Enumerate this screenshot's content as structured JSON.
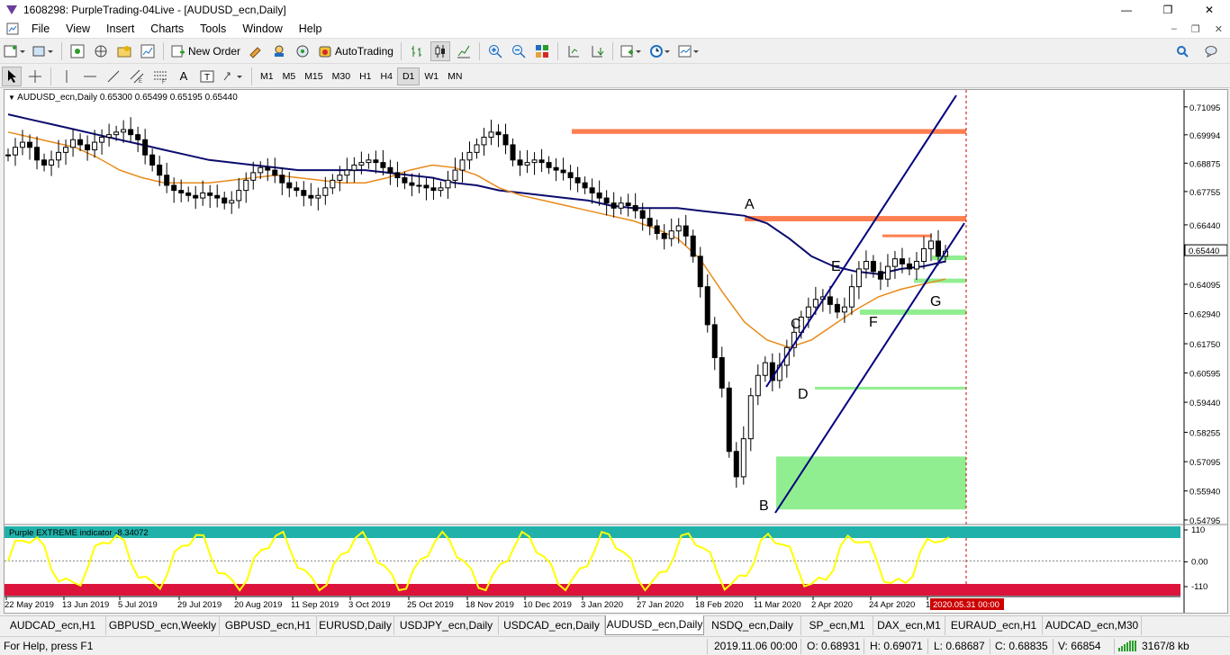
{
  "window": {
    "title": "1608298: PurpleTrading-04Live - [AUDUSD_ecn,Daily]",
    "minimize": "—",
    "maximize": "❐",
    "close": "✕"
  },
  "menu": [
    "File",
    "View",
    "Insert",
    "Charts",
    "Tools",
    "Window",
    "Help"
  ],
  "toolbar": {
    "new_order": "New Order",
    "autotrading": "AutoTrading",
    "timeframes": [
      "M1",
      "M5",
      "M15",
      "M30",
      "H1",
      "H4",
      "D1",
      "W1",
      "MN"
    ],
    "active_timeframe": "D1"
  },
  "chart": {
    "header": "AUDUSD_ecn,Daily  0.65300 0.65499 0.65195 0.65440",
    "current_price": "0.65440",
    "indicator_label": "Purple EXTREME indicator -8.34072",
    "indicator_levels": [
      "110",
      "0.00",
      "-110"
    ],
    "cursor_date": "2020.05.31 00:00",
    "wave_labels": [
      "A",
      "B",
      "C",
      "D",
      "E",
      "F",
      "G"
    ],
    "colors": {
      "resistance": "#ff7f50",
      "support": "#90ee90",
      "channel": "#00007f",
      "ma_slow": "#0b0b6e",
      "ma_fast": "#e88a1a",
      "indicator_line": "#ffff00",
      "indicator_top": "#20b2aa",
      "indicator_bottom": "#dc143c"
    }
  },
  "chart_data": {
    "type": "candlestick",
    "symbol": "AUDUSD_ecn",
    "timeframe": "Daily",
    "y_ticks": [
      "0.71095",
      "0.69994",
      "0.68875",
      "0.67755",
      "0.66440",
      "0.65440",
      "0.64095",
      "0.62940",
      "0.61750",
      "0.60595",
      "0.59440",
      "0.58255",
      "0.57095",
      "0.55940",
      "0.54795"
    ],
    "x_ticks": [
      "22 May 2019",
      "13 Jun 2019",
      "5 Jul 2019",
      "29 Jul 2019",
      "20 Aug 2019",
      "11 Sep 2019",
      "3 Oct 2019",
      "25 Oct 2019",
      "18 Nov 2019",
      "10 Dec 2019",
      "3 Jan 2020",
      "27 Jan 2020",
      "18 Feb 2020",
      "11 Mar 2020",
      "2 Apr 2020",
      "24 Apr 2020",
      "1"
    ],
    "ylim": [
      0.5465,
      0.7155
    ],
    "ohlc_last": {
      "open": 0.653,
      "high": 0.65499,
      "low": 0.65195,
      "close": 0.6544
    },
    "close_series": [
      0.692,
      0.695,
      0.697,
      0.695,
      0.69,
      0.688,
      0.69,
      0.693,
      0.695,
      0.698,
      0.696,
      0.694,
      0.697,
      0.699,
      0.7,
      0.701,
      0.702,
      0.7,
      0.698,
      0.692,
      0.688,
      0.684,
      0.68,
      0.678,
      0.677,
      0.676,
      0.675,
      0.677,
      0.676,
      0.675,
      0.673,
      0.674,
      0.678,
      0.682,
      0.685,
      0.687,
      0.686,
      0.684,
      0.681,
      0.679,
      0.678,
      0.676,
      0.675,
      0.676,
      0.679,
      0.682,
      0.684,
      0.686,
      0.688,
      0.689,
      0.69,
      0.689,
      0.687,
      0.685,
      0.683,
      0.681,
      0.68,
      0.68,
      0.679,
      0.678,
      0.679,
      0.682,
      0.686,
      0.69,
      0.693,
      0.696,
      0.699,
      0.701,
      0.7,
      0.696,
      0.69,
      0.688,
      0.689,
      0.69,
      0.689,
      0.687,
      0.686,
      0.685,
      0.683,
      0.681,
      0.679,
      0.677,
      0.675,
      0.673,
      0.671,
      0.673,
      0.672,
      0.67,
      0.667,
      0.664,
      0.661,
      0.659,
      0.662,
      0.664,
      0.66,
      0.652,
      0.64,
      0.625,
      0.612,
      0.6,
      0.575,
      0.565,
      0.58,
      0.597,
      0.605,
      0.61,
      0.603,
      0.609,
      0.616,
      0.622,
      0.628,
      0.632,
      0.635,
      0.636,
      0.633,
      0.63,
      0.632,
      0.64,
      0.647,
      0.65,
      0.646,
      0.643,
      0.648,
      0.651,
      0.649,
      0.647,
      0.65,
      0.655,
      0.658,
      0.652,
      0.654
    ],
    "ma_slow": [
      0.708,
      0.706,
      0.704,
      0.702,
      0.7,
      0.698,
      0.696,
      0.694,
      0.692,
      0.69,
      0.689,
      0.688,
      0.687,
      0.686,
      0.686,
      0.686,
      0.686,
      0.685,
      0.684,
      0.683,
      0.681,
      0.68,
      0.678,
      0.677,
      0.676,
      0.675,
      0.674,
      0.672,
      0.671,
      0.671,
      0.671,
      0.67,
      0.669,
      0.668,
      0.665,
      0.659,
      0.652,
      0.648,
      0.646,
      0.645,
      0.647,
      0.648,
      0.65
    ],
    "ma_fast": [
      0.701,
      0.699,
      0.697,
      0.695,
      0.691,
      0.686,
      0.683,
      0.681,
      0.681,
      0.681,
      0.682,
      0.683,
      0.684,
      0.683,
      0.682,
      0.681,
      0.681,
      0.683,
      0.686,
      0.688,
      0.687,
      0.684,
      0.679,
      0.676,
      0.674,
      0.672,
      0.67,
      0.668,
      0.666,
      0.663,
      0.659,
      0.651,
      0.638,
      0.626,
      0.619,
      0.616,
      0.619,
      0.625,
      0.631,
      0.636,
      0.639,
      0.641,
      0.643
    ],
    "levels": {
      "resistance": [
        [
          0.7003,
          0.7022
        ],
        [
          0.6658,
          0.6679
        ],
        [
          0.6597,
          0.6606
        ]
      ],
      "support": [
        [
          0.6505,
          0.6523
        ],
        [
          0.6415,
          0.6432
        ],
        [
          0.6289,
          0.631
        ],
        [
          0.5997,
          0.6005
        ],
        [
          0.5521,
          0.573
        ]
      ]
    },
    "indicator": {
      "name": "Purple EXTREME indicator",
      "last_value": -8.34072,
      "range": [
        -110,
        110
      ]
    },
    "grid": false
  },
  "tabs": [
    "AUDCAD_ecn,H1",
    "GBPUSD_ecn,Weekly",
    "GBPUSD_ecn,H1",
    "EURUSD,Daily",
    "USDJPY_ecn,Daily",
    "USDCAD_ecn,Daily",
    "AUDUSD_ecn,Daily",
    "NSDQ_ecn,Daily",
    "SP_ecn,M1",
    "DAX_ecn,M1",
    "EURAUD_ecn,H1",
    "AUDCAD_ecn,M30"
  ],
  "active_tab": "AUDUSD_ecn,Daily",
  "status": {
    "help": "For Help, press F1",
    "datetime": "2019.11.06 00:00",
    "open": "O: 0.68931",
    "high": "H: 0.69071",
    "low": "L: 0.68687",
    "close": "C: 0.68835",
    "volume": "V: 66854",
    "traffic": "3167/8 kb"
  }
}
